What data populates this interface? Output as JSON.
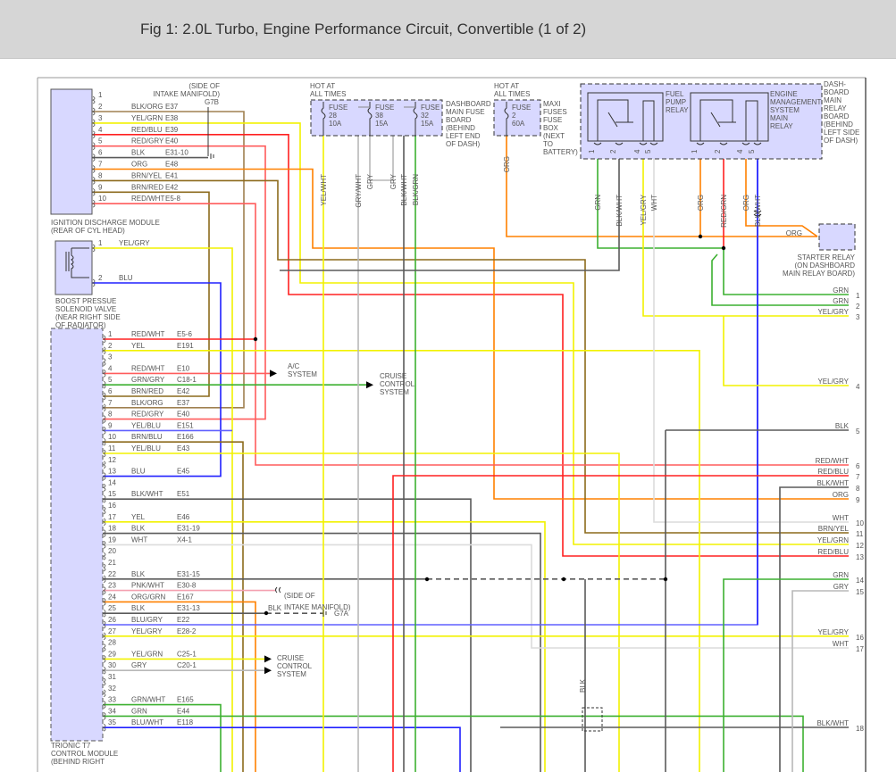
{
  "header": {
    "title": "Fig 1: 2.0L Turbo, Engine Performance Circuit, Convertible (1 of 2)"
  },
  "wire_colors": {
    "BLK": "#5a5a5a",
    "YEL": "#f2f200",
    "RED": "#ff2020",
    "REDW": "#ff5c5c",
    "BLU": "#2020ff",
    "GRN": "#3cb030",
    "ORG": "#ff8000",
    "BRN": "#8c6a1c",
    "BRNT": "#a08050",
    "GRY": "#b8b8b8",
    "WHT": "#dcdcdc",
    "PNK": "#f4a0b0",
    "BLUG": "#6060ff"
  },
  "ignition_module": {
    "label_1": "IGNITION DISCHARGE MODULE",
    "label_2": "(REAR OF CYL HEAD)",
    "pins": [
      {
        "n": "1",
        "color": "",
        "code": ""
      },
      {
        "n": "2",
        "color": "BLK/ORG",
        "code": "E37"
      },
      {
        "n": "3",
        "color": "YEL/GRN",
        "code": "E38"
      },
      {
        "n": "4",
        "color": "RED/BLU",
        "code": "E39"
      },
      {
        "n": "5",
        "color": "RED/GRY",
        "code": "E40"
      },
      {
        "n": "6",
        "color": "BLK",
        "code": "E31-10"
      },
      {
        "n": "7",
        "color": "ORG",
        "code": "E48"
      },
      {
        "n": "8",
        "color": "BRN/YEL",
        "code": "E41"
      },
      {
        "n": "9",
        "color": "BRN/RED",
        "code": "E42"
      },
      {
        "n": "10",
        "color": "RED/WHT",
        "code": "E5-8"
      }
    ]
  },
  "ground_g7b": {
    "line1": "(SIDE OF",
    "line2": "INTAKE MANIFOLD)",
    "id": "G7B"
  },
  "boost_valve": {
    "label_1": "BOOST PRESSUE",
    "label_2": "SOLENOID VALVE",
    "label_3": "(NEAR RIGHT SIDE",
    "label_4": "OF RADIATOR)",
    "pins": [
      {
        "n": "1",
        "color": "YEL/GRY"
      },
      {
        "n": "2",
        "color": "BLU"
      }
    ]
  },
  "trionic": {
    "label_1": "TRIONIC T7",
    "label_2": "CONTROL MODULE",
    "label_3": "(BEHIND RIGHT",
    "pins": [
      {
        "n": "1",
        "color": "RED/WHT",
        "code": "E5-6"
      },
      {
        "n": "2",
        "color": "YEL",
        "code": "E191"
      },
      {
        "n": "3",
        "color": "",
        "code": ""
      },
      {
        "n": "4",
        "color": "RED/WHT",
        "code": "E10"
      },
      {
        "n": "5",
        "color": "GRN/GRY",
        "code": "C18-1"
      },
      {
        "n": "6",
        "color": "BRN/RED",
        "code": "E42"
      },
      {
        "n": "7",
        "color": "BLK/ORG",
        "code": "E37"
      },
      {
        "n": "8",
        "color": "RED/GRY",
        "code": "E40"
      },
      {
        "n": "9",
        "color": "YEL/BLU",
        "code": "E151"
      },
      {
        "n": "10",
        "color": "BRN/BLU",
        "code": "E166"
      },
      {
        "n": "11",
        "color": "YEL/BLU",
        "code": "E43"
      },
      {
        "n": "12",
        "color": "",
        "code": ""
      },
      {
        "n": "13",
        "color": "BLU",
        "code": "E45"
      },
      {
        "n": "14",
        "color": "",
        "code": ""
      },
      {
        "n": "15",
        "color": "BLK/WHT",
        "code": "E51"
      },
      {
        "n": "16",
        "color": "",
        "code": ""
      },
      {
        "n": "17",
        "color": "YEL",
        "code": "E46"
      },
      {
        "n": "18",
        "color": "BLK",
        "code": "E31-19"
      },
      {
        "n": "19",
        "color": "WHT",
        "code": "X4-1"
      },
      {
        "n": "20",
        "color": "",
        "code": ""
      },
      {
        "n": "21",
        "color": "",
        "code": ""
      },
      {
        "n": "22",
        "color": "BLK",
        "code": "E31-15"
      },
      {
        "n": "23",
        "color": "PNK/WHT",
        "code": "E30-8"
      },
      {
        "n": "24",
        "color": "ORG/GRN",
        "code": "E167"
      },
      {
        "n": "25",
        "color": "BLK",
        "code": "E31-13"
      },
      {
        "n": "26",
        "color": "BLU/GRY",
        "code": "E22"
      },
      {
        "n": "27",
        "color": "YEL/GRY",
        "code": "E28-2"
      },
      {
        "n": "28",
        "color": "",
        "code": ""
      },
      {
        "n": "29",
        "color": "YEL/GRN",
        "code": "C25-1"
      },
      {
        "n": "30",
        "color": "GRY",
        "code": "C20-1"
      },
      {
        "n": "31",
        "color": "",
        "code": ""
      },
      {
        "n": "32",
        "color": "",
        "code": ""
      },
      {
        "n": "33",
        "color": "GRN/WHT",
        "code": "E165"
      },
      {
        "n": "34",
        "color": "GRN",
        "code": "E44"
      },
      {
        "n": "35",
        "color": "BLU/WHT",
        "code": "E118"
      }
    ]
  },
  "ac_system": {
    "line1": "A/C",
    "line2": "SYSTEM"
  },
  "cruise_1": {
    "line1": "CRUISE",
    "line2": "CONTROL",
    "line3": "SYSTEM"
  },
  "cruise_2": {
    "line1": "CRUISE",
    "line2": "CONTROL",
    "line3": "SYSTEM"
  },
  "ground_g7a": {
    "wire": "BLK",
    "line1": "(SIDE OF",
    "line2": "INTAKE MANIFOLD)",
    "id": "G7A"
  },
  "fuse_board": {
    "hot_1": "HOT AT",
    "hot_2": "ALL TIMES",
    "fuses": [
      {
        "name": "FUSE",
        "num": "28",
        "amps": "10A"
      },
      {
        "name": "FUSE",
        "num": "38",
        "amps": "15A"
      },
      {
        "name": "FUSE",
        "num": "32",
        "amps": "15A"
      }
    ],
    "desc": [
      "DASHBOARD",
      "MAIN FUSE",
      "BOARD",
      "(BEHIND",
      "LEFT END",
      "OF DASH)"
    ],
    "wires": [
      "YEL/WHT",
      "GRY/WHT",
      "GRY",
      "GRY",
      "BLK/WHT",
      "BLK/GRN"
    ]
  },
  "maxi_fuse": {
    "hot_1": "HOT AT",
    "hot_2": "ALL TIMES",
    "name": "FUSE",
    "num": "2",
    "amps": "60A",
    "desc": [
      "MAXI",
      "FUSES",
      "FUSE",
      "BOX",
      "(NEXT",
      "TO",
      "BATTERY)"
    ],
    "wire": "ORG"
  },
  "relay_board": {
    "desc": [
      "DASH-",
      "BOARD",
      "MAIN",
      "RELAY",
      "BOARD",
      "(BEHIND",
      "LEFT SIDE",
      "OF DASH)"
    ],
    "fuel_pump_relay": {
      "label": [
        "FUEL",
        "PUMP",
        "RELAY"
      ],
      "pins": [
        "1",
        "2",
        "4",
        "5"
      ],
      "wires": [
        "GRN",
        "BLK/WHT",
        "YEL/GRY",
        "WHT"
      ]
    },
    "ems_relay": {
      "label": [
        "ENGINE",
        "MANAGEMENT",
        "SYSTEM",
        "MAIN",
        "RELAY"
      ],
      "pins": [
        "1",
        "2",
        "4",
        "5"
      ],
      "wires": [
        "ORG",
        "RED/GRN",
        "ORG",
        "BLU/WHT"
      ]
    }
  },
  "starter_relay": {
    "wire": "ORG",
    "label": [
      "STARTER RELAY",
      "(ON DASHBOARD",
      "MAIN RELAY BOARD)"
    ]
  },
  "splice_blk": "BLK",
  "right_pins": [
    {
      "n": "1",
      "label": "GRN"
    },
    {
      "n": "2",
      "label": "GRN"
    },
    {
      "n": "3",
      "label": "YEL/GRY"
    },
    {
      "n": "4",
      "label": "YEL/GRY"
    },
    {
      "n": "5",
      "label": "BLK"
    },
    {
      "n": "6",
      "label": "RED/WHT"
    },
    {
      "n": "7",
      "label": "RED/BLU"
    },
    {
      "n": "8",
      "label": "BLK/WHT"
    },
    {
      "n": "9",
      "label": "ORG"
    },
    {
      "n": "10",
      "label": "WHT"
    },
    {
      "n": "11",
      "label": "BRN/YEL"
    },
    {
      "n": "12",
      "label": "YEL/GRN"
    },
    {
      "n": "13",
      "label": "RED/BLU"
    },
    {
      "n": "14",
      "label": "GRN"
    },
    {
      "n": "15",
      "label": "GRY"
    },
    {
      "n": "16",
      "label": "YEL/GRY"
    },
    {
      "n": "17",
      "label": "WHT"
    },
    {
      "n": "18",
      "label": "BLK/WHT"
    }
  ]
}
